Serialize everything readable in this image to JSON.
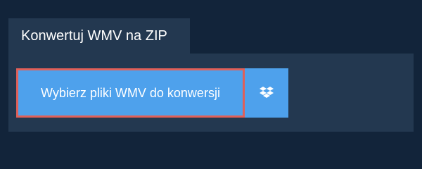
{
  "tab": {
    "title": "Konwertuj WMV na ZIP"
  },
  "upload": {
    "choose_button_label": "Wybierz pliki WMV do konwersji",
    "dropbox_icon": "dropbox-icon"
  },
  "colors": {
    "background": "#12243a",
    "panel": "#233850",
    "button": "#4ea1ec",
    "focus_outline": "#e06059",
    "text": "#ffffff"
  }
}
